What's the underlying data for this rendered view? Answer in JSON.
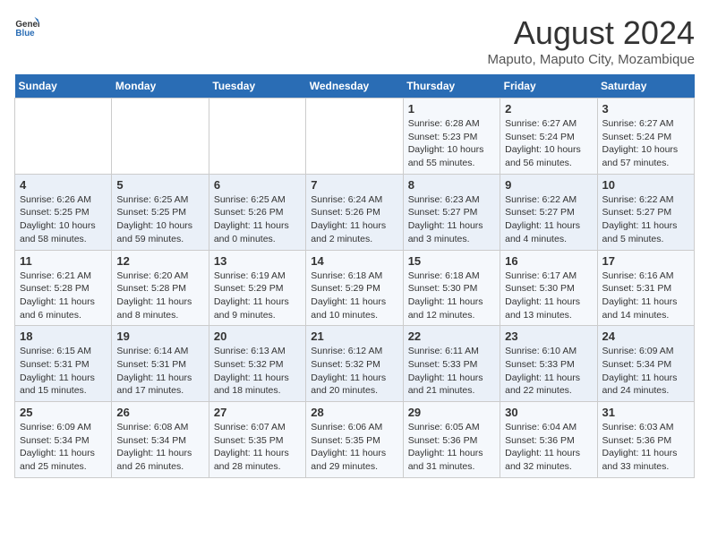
{
  "header": {
    "logo_general": "General",
    "logo_blue": "Blue",
    "title": "August 2024",
    "subtitle": "Maputo, Maputo City, Mozambique"
  },
  "weekdays": [
    "Sunday",
    "Monday",
    "Tuesday",
    "Wednesday",
    "Thursday",
    "Friday",
    "Saturday"
  ],
  "weeks": [
    [
      {
        "day": "",
        "content": ""
      },
      {
        "day": "",
        "content": ""
      },
      {
        "day": "",
        "content": ""
      },
      {
        "day": "",
        "content": ""
      },
      {
        "day": "1",
        "content": "Sunrise: 6:28 AM\nSunset: 5:23 PM\nDaylight: 10 hours and 55 minutes."
      },
      {
        "day": "2",
        "content": "Sunrise: 6:27 AM\nSunset: 5:24 PM\nDaylight: 10 hours and 56 minutes."
      },
      {
        "day": "3",
        "content": "Sunrise: 6:27 AM\nSunset: 5:24 PM\nDaylight: 10 hours and 57 minutes."
      }
    ],
    [
      {
        "day": "4",
        "content": "Sunrise: 6:26 AM\nSunset: 5:25 PM\nDaylight: 10 hours and 58 minutes."
      },
      {
        "day": "5",
        "content": "Sunrise: 6:25 AM\nSunset: 5:25 PM\nDaylight: 10 hours and 59 minutes."
      },
      {
        "day": "6",
        "content": "Sunrise: 6:25 AM\nSunset: 5:26 PM\nDaylight: 11 hours and 0 minutes."
      },
      {
        "day": "7",
        "content": "Sunrise: 6:24 AM\nSunset: 5:26 PM\nDaylight: 11 hours and 2 minutes."
      },
      {
        "day": "8",
        "content": "Sunrise: 6:23 AM\nSunset: 5:27 PM\nDaylight: 11 hours and 3 minutes."
      },
      {
        "day": "9",
        "content": "Sunrise: 6:22 AM\nSunset: 5:27 PM\nDaylight: 11 hours and 4 minutes."
      },
      {
        "day": "10",
        "content": "Sunrise: 6:22 AM\nSunset: 5:27 PM\nDaylight: 11 hours and 5 minutes."
      }
    ],
    [
      {
        "day": "11",
        "content": "Sunrise: 6:21 AM\nSunset: 5:28 PM\nDaylight: 11 hours and 6 minutes."
      },
      {
        "day": "12",
        "content": "Sunrise: 6:20 AM\nSunset: 5:28 PM\nDaylight: 11 hours and 8 minutes."
      },
      {
        "day": "13",
        "content": "Sunrise: 6:19 AM\nSunset: 5:29 PM\nDaylight: 11 hours and 9 minutes."
      },
      {
        "day": "14",
        "content": "Sunrise: 6:18 AM\nSunset: 5:29 PM\nDaylight: 11 hours and 10 minutes."
      },
      {
        "day": "15",
        "content": "Sunrise: 6:18 AM\nSunset: 5:30 PM\nDaylight: 11 hours and 12 minutes."
      },
      {
        "day": "16",
        "content": "Sunrise: 6:17 AM\nSunset: 5:30 PM\nDaylight: 11 hours and 13 minutes."
      },
      {
        "day": "17",
        "content": "Sunrise: 6:16 AM\nSunset: 5:31 PM\nDaylight: 11 hours and 14 minutes."
      }
    ],
    [
      {
        "day": "18",
        "content": "Sunrise: 6:15 AM\nSunset: 5:31 PM\nDaylight: 11 hours and 15 minutes."
      },
      {
        "day": "19",
        "content": "Sunrise: 6:14 AM\nSunset: 5:31 PM\nDaylight: 11 hours and 17 minutes."
      },
      {
        "day": "20",
        "content": "Sunrise: 6:13 AM\nSunset: 5:32 PM\nDaylight: 11 hours and 18 minutes."
      },
      {
        "day": "21",
        "content": "Sunrise: 6:12 AM\nSunset: 5:32 PM\nDaylight: 11 hours and 20 minutes."
      },
      {
        "day": "22",
        "content": "Sunrise: 6:11 AM\nSunset: 5:33 PM\nDaylight: 11 hours and 21 minutes."
      },
      {
        "day": "23",
        "content": "Sunrise: 6:10 AM\nSunset: 5:33 PM\nDaylight: 11 hours and 22 minutes."
      },
      {
        "day": "24",
        "content": "Sunrise: 6:09 AM\nSunset: 5:34 PM\nDaylight: 11 hours and 24 minutes."
      }
    ],
    [
      {
        "day": "25",
        "content": "Sunrise: 6:09 AM\nSunset: 5:34 PM\nDaylight: 11 hours and 25 minutes."
      },
      {
        "day": "26",
        "content": "Sunrise: 6:08 AM\nSunset: 5:34 PM\nDaylight: 11 hours and 26 minutes."
      },
      {
        "day": "27",
        "content": "Sunrise: 6:07 AM\nSunset: 5:35 PM\nDaylight: 11 hours and 28 minutes."
      },
      {
        "day": "28",
        "content": "Sunrise: 6:06 AM\nSunset: 5:35 PM\nDaylight: 11 hours and 29 minutes."
      },
      {
        "day": "29",
        "content": "Sunrise: 6:05 AM\nSunset: 5:36 PM\nDaylight: 11 hours and 31 minutes."
      },
      {
        "day": "30",
        "content": "Sunrise: 6:04 AM\nSunset: 5:36 PM\nDaylight: 11 hours and 32 minutes."
      },
      {
        "day": "31",
        "content": "Sunrise: 6:03 AM\nSunset: 5:36 PM\nDaylight: 11 hours and 33 minutes."
      }
    ]
  ]
}
